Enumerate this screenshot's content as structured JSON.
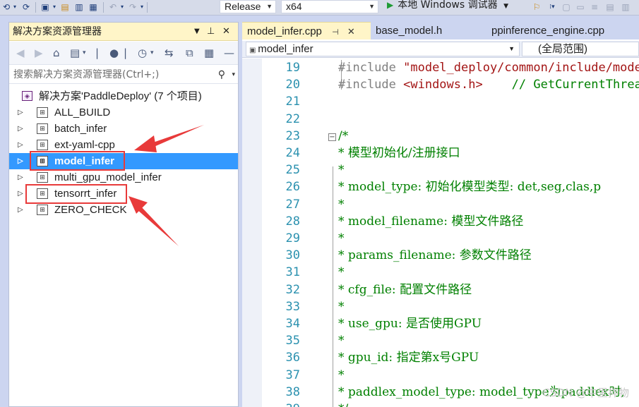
{
  "toolbar": {
    "config": "Release",
    "platform": "x64",
    "run_label": "本地 Windows 调试器"
  },
  "explorer": {
    "title": "解决方案资源管理器",
    "search_placeholder": "搜索解决方案资源管理器(Ctrl+;)",
    "solution": "解决方案'PaddleDeploy' (7 个项目)",
    "projects": [
      {
        "label": "ALL_BUILD",
        "selected": false
      },
      {
        "label": "batch_infer",
        "selected": false
      },
      {
        "label": "ext-yaml-cpp",
        "selected": false
      },
      {
        "label": "model_infer",
        "selected": true
      },
      {
        "label": "multi_gpu_model_infer",
        "selected": false
      },
      {
        "label": "tensorrt_infer",
        "selected": false
      },
      {
        "label": "ZERO_CHECK",
        "selected": false
      }
    ]
  },
  "editor": {
    "tabs": [
      {
        "label": "model_infer.cpp",
        "active": true
      },
      {
        "label": "base_model.h",
        "active": false
      },
      {
        "label": "ppinference_engine.cpp",
        "active": false
      }
    ],
    "nav_scope": "model_infer",
    "nav_member": "(全局范围)",
    "lines": [
      {
        "n": "19",
        "text": "#include \"model_deploy/common/include/model_"
      },
      {
        "n": "20",
        "text": "#include <windows.h>    // GetCurrentThreadI"
      },
      {
        "n": "21",
        "text": ""
      },
      {
        "n": "22",
        "text": ""
      },
      {
        "n": "23",
        "text": "/*"
      },
      {
        "n": "24",
        "text": "* 模型初始化/注册接口"
      },
      {
        "n": "25",
        "text": "*"
      },
      {
        "n": "26",
        "text": "* model_type: 初始化模型类型: det,seg,clas,p"
      },
      {
        "n": "27",
        "text": "*"
      },
      {
        "n": "28",
        "text": "* model_filename: 模型文件路径"
      },
      {
        "n": "29",
        "text": "*"
      },
      {
        "n": "30",
        "text": "* params_filename: 参数文件路径"
      },
      {
        "n": "31",
        "text": "*"
      },
      {
        "n": "32",
        "text": "* cfg_file: 配置文件路径"
      },
      {
        "n": "33",
        "text": "*"
      },
      {
        "n": "34",
        "text": "* use_gpu: 是否使用GPU"
      },
      {
        "n": "35",
        "text": "*"
      },
      {
        "n": "36",
        "text": "* gpu_id: 指定第x号GPU"
      },
      {
        "n": "37",
        "text": "*"
      },
      {
        "n": "38",
        "text": "* paddlex_model_type: model_type为paddlex时,"
      },
      {
        "n": "39",
        "text": "*/"
      }
    ],
    "watermark": "CSDN @中里拌物"
  },
  "colors": {
    "selection": "#3399ff",
    "annotation_red": "#e83a3a",
    "line_number": "#2b91af",
    "comment": "#008000"
  }
}
